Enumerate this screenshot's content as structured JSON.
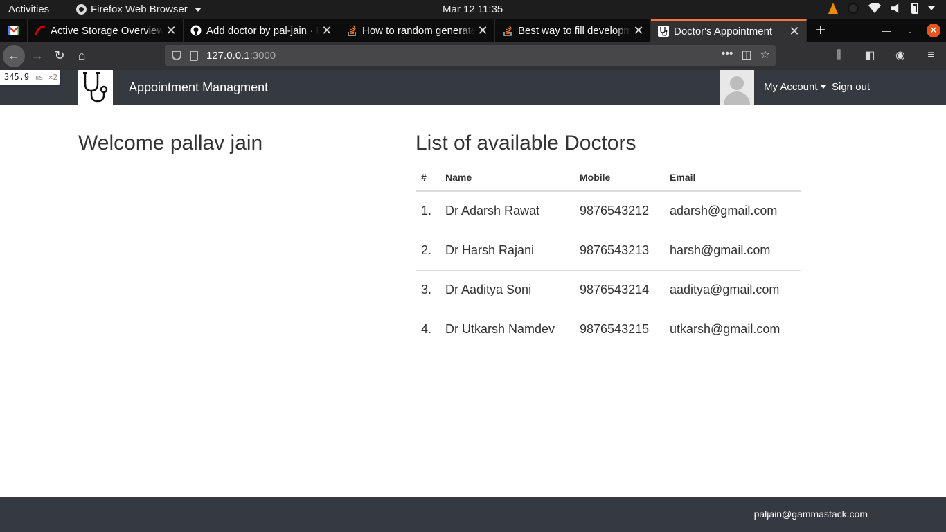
{
  "system": {
    "activities_label": "Activities",
    "app_name": "Firefox Web Browser",
    "clock": "Mar 12  11:35"
  },
  "browser": {
    "tabs": [
      {
        "title": "",
        "icon": "gmail-icon",
        "pinned": true
      },
      {
        "title": "Active Storage Overview",
        "icon": "rails-icon"
      },
      {
        "title": "Add doctor by pal-jain · P",
        "icon": "github-icon"
      },
      {
        "title": "How to random generate",
        "icon": "stackoverflow-icon"
      },
      {
        "title": "Best way to fill developm",
        "icon": "stackoverflow-icon"
      },
      {
        "title": "Doctor's Appointment",
        "icon": "stethoscope-icon",
        "active": true
      }
    ],
    "url_host": "127.0.0.1",
    "url_port": ":3000"
  },
  "perf_badge": {
    "value": "345.9",
    "unit": "ms",
    "multiplier": "×2"
  },
  "site": {
    "title": "Appointment Managment",
    "account_label": "My Account",
    "signout_label": "Sign out",
    "welcome": "Welcome pallav jain",
    "list_heading": "List of available Doctors",
    "table": {
      "headers": {
        "num": "#",
        "name": "Name",
        "mobile": "Mobile",
        "email": "Email"
      },
      "rows": [
        {
          "num": "1.",
          "name": "Dr Adarsh Rawat",
          "mobile": "9876543212",
          "email": "adarsh@gmail.com"
        },
        {
          "num": "2.",
          "name": "Dr Harsh Rajani",
          "mobile": "9876543213",
          "email": "harsh@gmail.com"
        },
        {
          "num": "3.",
          "name": "Dr Aaditya Soni",
          "mobile": "9876543214",
          "email": "aaditya@gmail.com"
        },
        {
          "num": "4.",
          "name": "Dr Utkarsh Namdev",
          "mobile": "9876543215",
          "email": "utkarsh@gmail.com"
        }
      ]
    },
    "footer_email": "paljain@gammastack.com"
  },
  "colors": {
    "site_nav_bg": "#343a3f",
    "active_tab_accent": "#ff7139",
    "window_close": "#e95420"
  }
}
